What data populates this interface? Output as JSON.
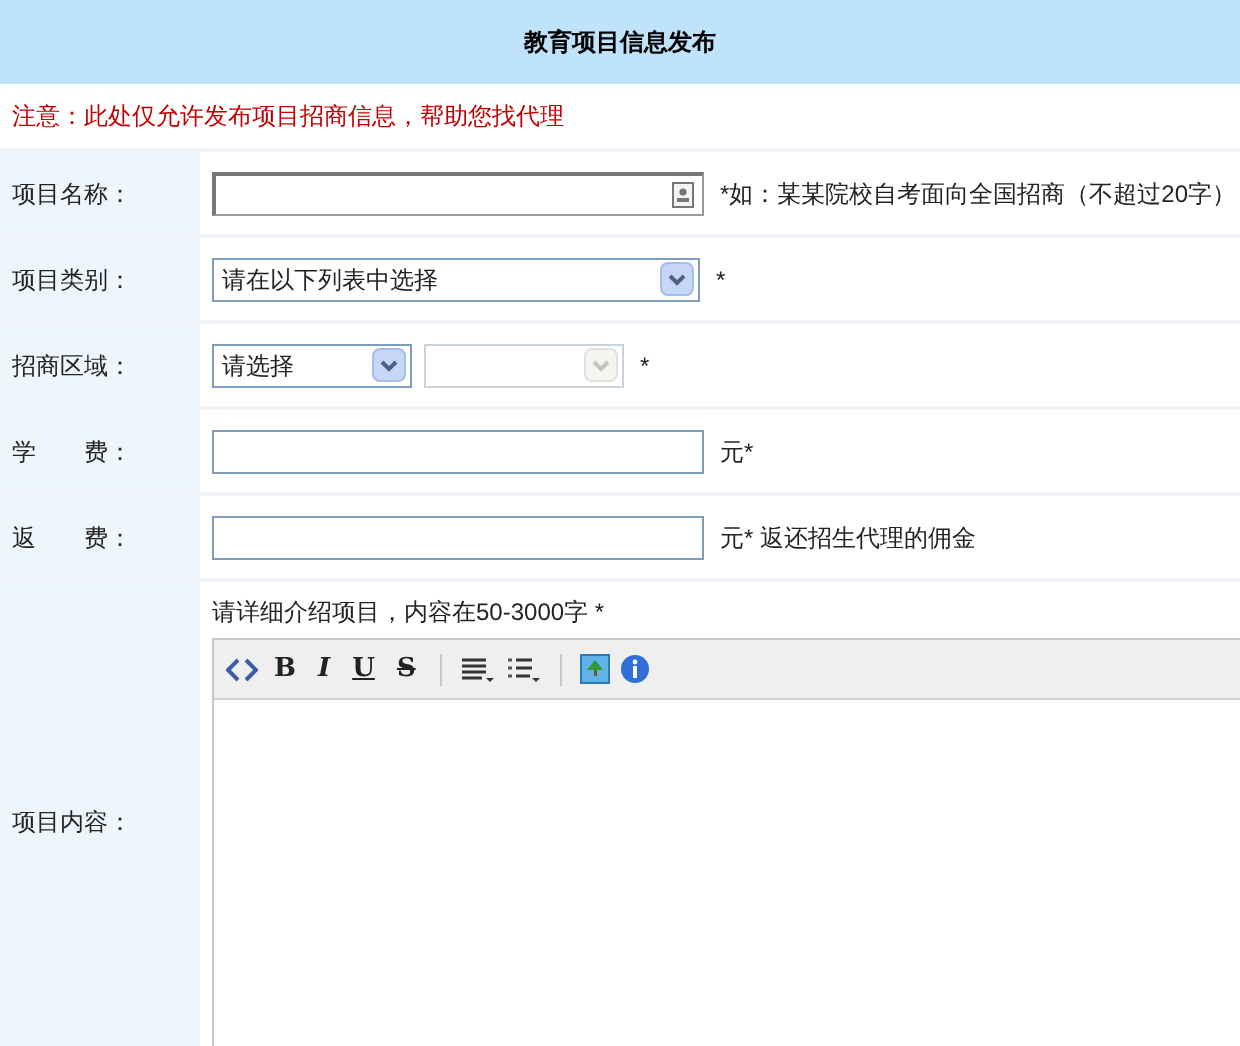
{
  "title": "教育项目信息发布",
  "notice": "注意：此处仅允许发布项目招商信息，帮助您找代理",
  "rows": [
    {
      "kind": "text",
      "label": "项目名称：",
      "value_icon": true,
      "hint": "*如：某某院校自考面向全国招商（不超过20字）"
    },
    {
      "kind": "select",
      "label": "项目类别：",
      "selects": [
        {
          "value": "请在以下列表中选择",
          "disabled": false
        }
      ],
      "hint": "*"
    },
    {
      "kind": "select",
      "label": "招商区域：",
      "selects": [
        {
          "value": "请选择",
          "disabled": false
        },
        {
          "disabled": true
        }
      ],
      "hint": "*"
    },
    {
      "kind": "text",
      "label": "学　　费：",
      "value_icon": false,
      "hint": "元*"
    },
    {
      "kind": "text",
      "label": "返　　费：",
      "value_icon": false,
      "hint": "元* 返还招生代理的佣金"
    }
  ],
  "content": {
    "label": "项目内容：",
    "instruction": "请详细介绍项目，内容在50-3000字 *",
    "toolbar": [
      {
        "kind": "source"
      },
      {
        "kind": "letter",
        "label": "B"
      },
      {
        "kind": "letter",
        "label": "I"
      },
      {
        "kind": "letter",
        "label": "U"
      },
      {
        "kind": "letter",
        "label": "S"
      },
      {
        "kind": "sep"
      },
      {
        "kind": "align"
      },
      {
        "kind": "list"
      },
      {
        "kind": "sep"
      },
      {
        "kind": "image"
      },
      {
        "kind": "info"
      }
    ]
  }
}
